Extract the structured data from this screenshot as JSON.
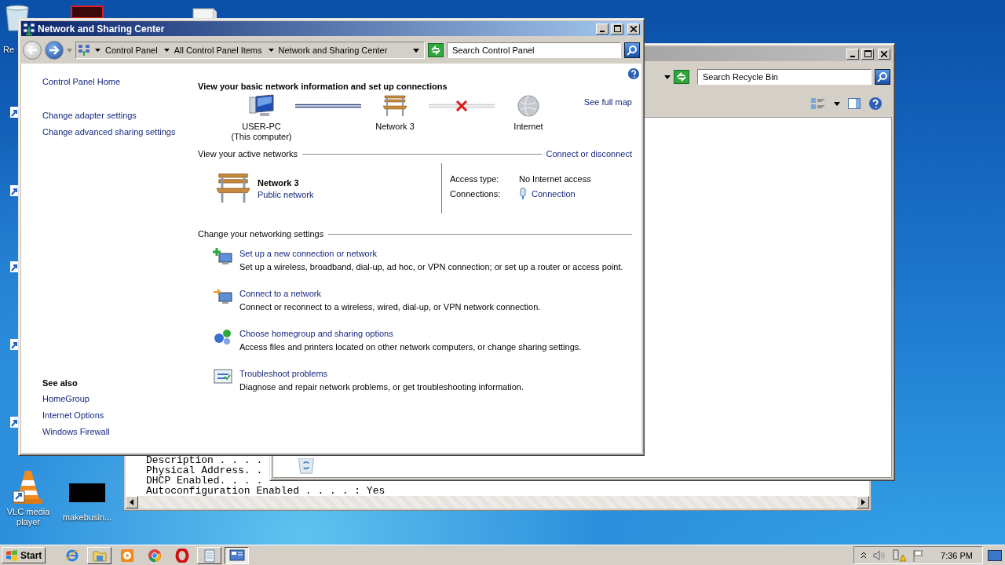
{
  "desktop": {
    "icons": [
      {
        "kind": "recycle",
        "label": "Re"
      },
      {
        "kind": "vlc",
        "label": "VLC media player"
      },
      {
        "kind": "black",
        "label": "makebusin..."
      }
    ]
  },
  "console": {
    "lines": [
      "Description . . . .",
      "Physical Address. .",
      "DHCP Enabled. . . .",
      "Autoconfiguration Enabled . . . . : Yes"
    ]
  },
  "recycle_window": {
    "search": {
      "placeholder": "Search Recycle Bin"
    }
  },
  "window": {
    "title": "Network and Sharing Center",
    "breadcrumb": [
      "Control Panel",
      "All Control Panel Items",
      "Network and Sharing Center"
    ],
    "search": {
      "placeholder": "Search Control Panel"
    },
    "sidebar": {
      "links": [
        "Control Panel Home",
        "Change adapter settings",
        "Change advanced sharing settings"
      ],
      "see_also_title": "See also",
      "see_also": [
        "HomeGroup",
        "Internet Options",
        "Windows Firewall"
      ]
    },
    "heading": "View your basic network information and set up connections",
    "map": {
      "nodes": [
        {
          "kind": "computer",
          "label": "USER-PC",
          "sublabel": "(This computer)"
        },
        {
          "kind": "bench",
          "label": "Network  3"
        },
        {
          "kind": "globe",
          "label": "Internet"
        }
      ],
      "links": [
        {
          "broken": false
        },
        {
          "broken": true
        }
      ],
      "full_map": "See full map"
    },
    "active": {
      "title": "View your active networks",
      "action": "Connect or disconnect",
      "network": {
        "name": "Network  3",
        "type": "Public network"
      },
      "properties": [
        {
          "label": "Access type:",
          "value": "No Internet access",
          "link": false
        },
        {
          "label": "Connections:",
          "value": "Connection",
          "link": true
        }
      ]
    },
    "settings": {
      "title": "Change your networking settings",
      "tasks": [
        {
          "kind": "new",
          "title": "Set up a new connection or network",
          "description": "Set up a wireless, broadband, dial-up, ad hoc, or VPN connection; or set up a router or access point."
        },
        {
          "kind": "connect",
          "title": "Connect to a network",
          "description": "Connect or reconnect to a wireless, wired, dial-up, or VPN network connection."
        },
        {
          "kind": "homegroup",
          "title": "Choose homegroup and sharing options",
          "description": "Access files and printers located on other network computers, or change sharing settings."
        },
        {
          "kind": "troubleshoot",
          "title": "Troubleshoot problems",
          "description": "Diagnose and repair network problems, or get troubleshooting information."
        }
      ]
    }
  },
  "taskbar": {
    "start": "Start",
    "apps": [
      {
        "kind": "ie",
        "open": false,
        "selected": false
      },
      {
        "kind": "folder",
        "open": true,
        "selected": false
      },
      {
        "kind": "media",
        "open": false,
        "selected": false
      },
      {
        "kind": "chrome",
        "open": false,
        "selected": false
      },
      {
        "kind": "opera",
        "open": false,
        "selected": false
      },
      {
        "kind": "notepad",
        "open": true,
        "selected": false
      },
      {
        "kind": "network",
        "open": true,
        "selected": true
      }
    ],
    "clock": "7:36 PM"
  }
}
